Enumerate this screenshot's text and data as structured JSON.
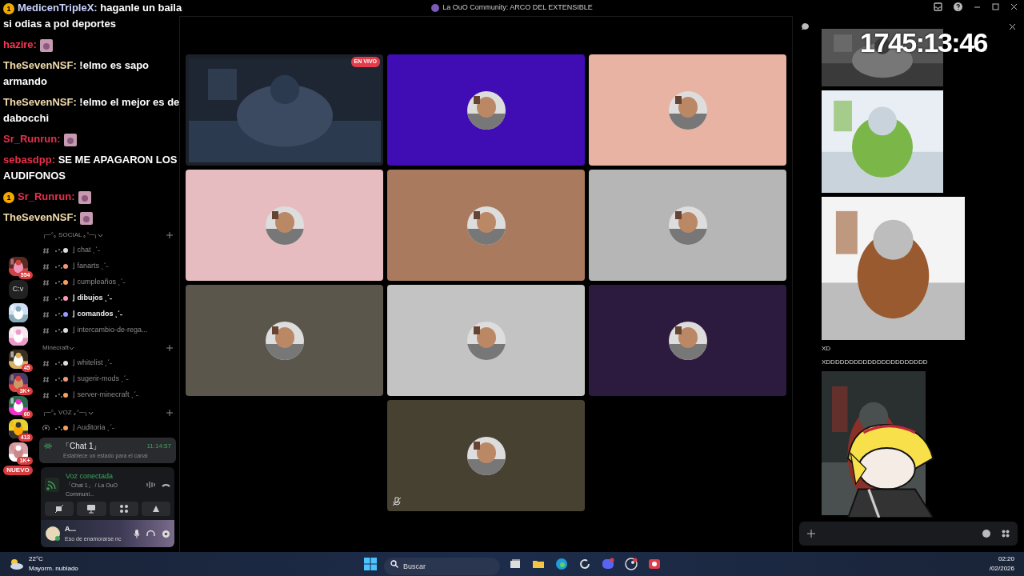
{
  "window": {
    "title": "La OuO Community: ARCO DEL EXTENSIBLE"
  },
  "stream_chat": [
    {
      "name": "MedicenTripleX:",
      "color": "#c9d4ff",
      "badge": "1",
      "kind": "text",
      "text": "haganle un baila si odias a pol deportes"
    },
    {
      "name": "hazire:",
      "color": "#ff3355",
      "kind": "emote"
    },
    {
      "name": "TheSevenNSF:",
      "color": "#f2dcae",
      "kind": "text",
      "text": "!elmo es sapo armando"
    },
    {
      "name": "TheSevenNSF:",
      "color": "#f2dcae",
      "kind": "text",
      "text": "!elmo el mejor es de dabocchi"
    },
    {
      "name": "Sr_Runrun:",
      "color": "#e8304c",
      "kind": "emote"
    },
    {
      "name": "sebasdpp:",
      "color": "#e8304c",
      "kind": "text",
      "text": "SE ME APAGARON LOS AUDIFONOS"
    },
    {
      "name": "Sr_Runrun:",
      "color": "#e8304c",
      "badge": "1",
      "kind": "emote"
    },
    {
      "name": "TheSevenNSF:",
      "color": "#f2dcae",
      "kind": "emote"
    }
  ],
  "server_rail": [
    {
      "badge": "554"
    },
    {
      "label": "C:v"
    },
    {
      "kind": "picture"
    },
    {
      "kind": "picture"
    },
    {
      "badge": "45"
    },
    {
      "badge": "3K+"
    },
    {
      "badge": "60"
    },
    {
      "badge": "413"
    },
    {
      "badge": "1K+"
    },
    {
      "badge": "NUEVO"
    }
  ],
  "sidebar": {
    "categories": [
      {
        "title": "╭─°｡ SOCIAL ｡°─╮",
        "channels": [
          {
            "kind": "text",
            "name": "⌋ chat ˎˊ˗",
            "unread": false
          },
          {
            "kind": "text",
            "name": "⌋ fanarts ˎˊ˗",
            "unread": false
          },
          {
            "kind": "text",
            "name": "⌋ cumpleaños ˎˊ˗",
            "unread": false
          },
          {
            "kind": "text",
            "name": "⌋ dibujos ˎˊ˗",
            "unread": true
          },
          {
            "kind": "text",
            "name": "⌋ comandos ˎˊ˗",
            "unread": true
          },
          {
            "kind": "text",
            "name": "⌋ intercambio-de-rega...",
            "unread": false
          }
        ]
      },
      {
        "title": "Minecraft",
        "channels": [
          {
            "kind": "text",
            "name": "⌋ whitelist ˎˊ˗",
            "unread": false
          },
          {
            "kind": "text",
            "name": "⌋ sugerir-mods ˎˊ˗",
            "unread": false
          },
          {
            "kind": "text",
            "name": "⌋ server-minecraft ˎˊ˗",
            "unread": false
          }
        ]
      },
      {
        "title": "╭─°｡ VOZ ｡°─╮",
        "channels": [
          {
            "kind": "voice",
            "name": "⌋ Auditoria ˎˊ˗",
            "selected": false
          },
          {
            "kind": "voice",
            "name": "「Chat 1」",
            "selected": true,
            "time": "11:14:57",
            "status": "Establece un estado para el canal"
          }
        ]
      }
    ]
  },
  "voice_panel": {
    "status": "Voz conectada",
    "channel": "「Chat 1」 / La OuO Communi..."
  },
  "user": {
    "name": "A...",
    "status": "Eso de enamorarse nc"
  },
  "stage": [
    {
      "kind": "screen",
      "live": "EN VIVO"
    },
    {
      "kind": "avatar",
      "color": "#3f0db3",
      "muted": false
    },
    {
      "kind": "avatar",
      "color": "#e8b3a2",
      "muted": false
    },
    {
      "kind": "avatar",
      "color": "#e6bcc1",
      "muted": false
    },
    {
      "kind": "avatar",
      "color": "#a97a5d",
      "muted": false
    },
    {
      "kind": "avatar",
      "color": "#b6b6b6",
      "muted": false
    },
    {
      "kind": "avatar",
      "color": "#5b564b",
      "muted": false
    },
    {
      "kind": "avatar",
      "color": "#c3c3c3",
      "muted": false
    },
    {
      "kind": "avatar",
      "color": "#2d1b3f",
      "muted": false
    },
    {
      "kind": "avatar",
      "color": "#474131",
      "muted": true
    }
  ],
  "timer": "1745:13:46",
  "chat_panel": {
    "messages": [
      {
        "kind": "picture"
      },
      {
        "kind": "picture"
      },
      {
        "kind": "picture"
      },
      {
        "kind": "text",
        "text": "XD"
      },
      {
        "kind": "text",
        "text": "XDDDDDDDDDDDDDDDDDDDDDD"
      },
      {
        "kind": "picture"
      }
    ]
  },
  "taskbar": {
    "temperature": "22°C",
    "weather": "Mayorm. nublado",
    "search": {
      "placeholder": "Buscar"
    },
    "time": "02:20",
    "date": "/02/2026"
  }
}
